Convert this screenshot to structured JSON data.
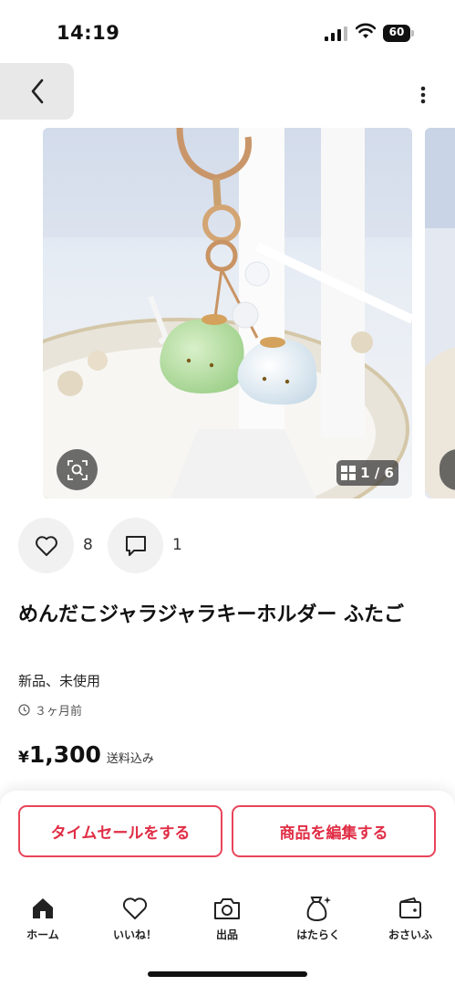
{
  "status_bar": {
    "time": "14:19",
    "battery": "60"
  },
  "product": {
    "photo_counter": "1 / 6",
    "likes": "8",
    "comments": "1",
    "title": "めんだこジャラジャラキーホルダー ふたご",
    "condition": "新品、未使用",
    "posted": "３ヶ月前",
    "price_symbol": "¥",
    "price": "1,300",
    "shipping": "送料込み"
  },
  "actions": {
    "timesale_label": "タイムセールをする",
    "edit_label": "商品を編集する"
  },
  "tabs": [
    {
      "label": "ホーム",
      "icon": "home-icon"
    },
    {
      "label": "いいね！",
      "icon": "heart-icon"
    },
    {
      "label": "出品",
      "icon": "camera-icon"
    },
    {
      "label": "はたらく",
      "icon": "money-bag-icon"
    },
    {
      "label": "おさいふ",
      "icon": "wallet-icon"
    }
  ],
  "colors": {
    "accent": "#e02d45",
    "button_bg": "#f1f1f1"
  }
}
